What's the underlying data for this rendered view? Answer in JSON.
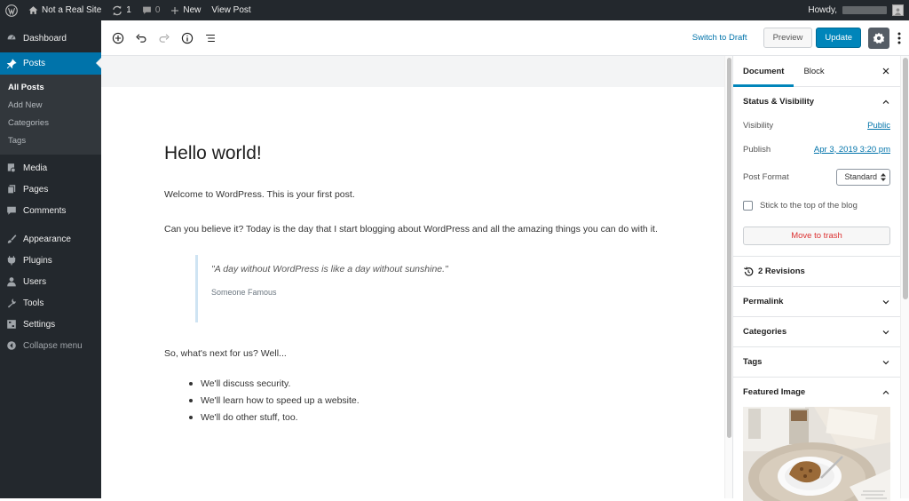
{
  "adminbar": {
    "site_name": "Not a Real Site",
    "updates_count": "1",
    "comments_count": "0",
    "new_label": "New",
    "view_post_label": "View Post",
    "howdy": "Howdy,"
  },
  "sidebar": {
    "items": [
      {
        "label": "Dashboard",
        "icon": "dashboard-icon"
      },
      {
        "label": "Posts",
        "icon": "pin-icon"
      },
      {
        "label": "Media",
        "icon": "media-icon"
      },
      {
        "label": "Pages",
        "icon": "pages-icon"
      },
      {
        "label": "Comments",
        "icon": "comment-icon"
      },
      {
        "label": "Appearance",
        "icon": "brush-icon"
      },
      {
        "label": "Plugins",
        "icon": "plug-icon"
      },
      {
        "label": "Users",
        "icon": "user-icon"
      },
      {
        "label": "Tools",
        "icon": "wrench-icon"
      },
      {
        "label": "Settings",
        "icon": "settings-icon"
      }
    ],
    "submenu": [
      "All Posts",
      "Add New",
      "Categories",
      "Tags"
    ],
    "collapse_label": "Collapse menu"
  },
  "header": {
    "switch_to_draft": "Switch to Draft",
    "preview": "Preview",
    "update": "Update"
  },
  "post": {
    "title": "Hello world!",
    "p1": "Welcome to WordPress. This is your first post.",
    "p2": "Can you believe it? Today is the day that I start blogging about WordPress and all the amazing things you can do with it.",
    "quote": "\"A day without WordPress is like a day without sunshine.\"",
    "cite": "Someone Famous",
    "p3": "So, what's next for us? Well...",
    "list": [
      "We'll discuss security.",
      "We'll learn how to speed up a website.",
      "We'll do other stuff, too."
    ]
  },
  "panel": {
    "tab_document": "Document",
    "tab_block": "Block",
    "status_title": "Status & Visibility",
    "visibility_label": "Visibility",
    "visibility_value": "Public",
    "publish_label": "Publish",
    "publish_value": "Apr 3, 2019 3:20 pm",
    "format_label": "Post Format",
    "format_value": "Standard",
    "sticky_label": "Stick to the top of the blog",
    "trash_label": "Move to trash",
    "revisions_label": "2 Revisions",
    "permalink": "Permalink",
    "categories": "Categories",
    "tags": "Tags",
    "featured_image": "Featured Image"
  },
  "colors": {
    "admin_dark": "#23282d",
    "accent": "#0073aa",
    "update_blue": "#0085ba",
    "trash_red": "#dc3232"
  }
}
